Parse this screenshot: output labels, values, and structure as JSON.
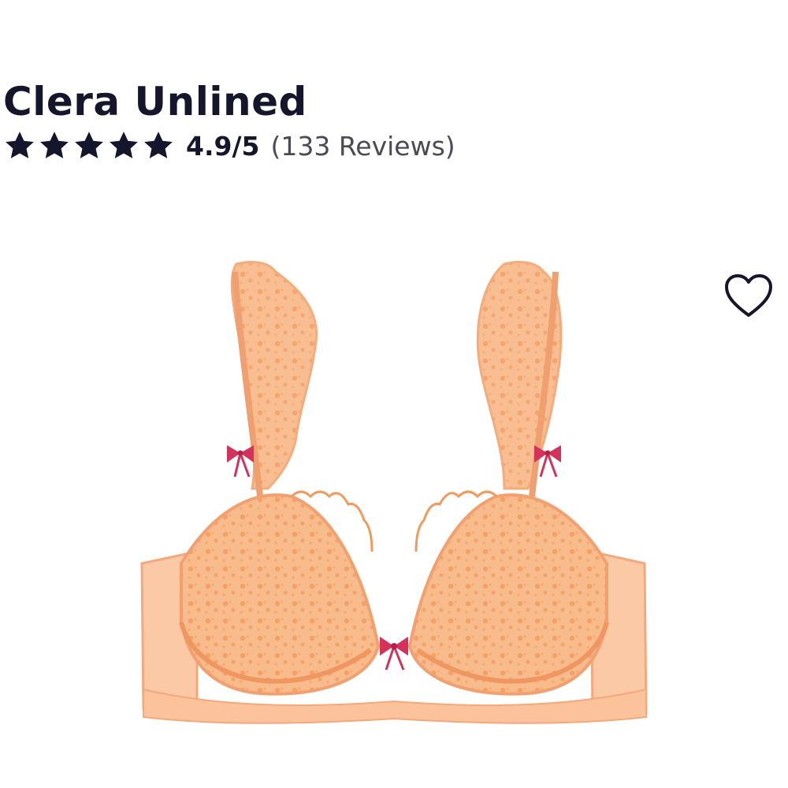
{
  "product": {
    "title": "Clera Unlined",
    "rating": {
      "stars_filled": 5,
      "stars_total": 5,
      "score_text": "4.9/5",
      "reviews_text": "(133 Reviews)"
    },
    "image": {
      "alt": "Clera Unlined"
    },
    "wishlist_icon": "heart-outline-icon"
  },
  "colors": {
    "text": "#15152b",
    "secondary_text": "#4a4a55",
    "star": "#15152b",
    "product_peach": "#f7b07c",
    "product_lace": "#f29a5c",
    "bow": "#d4325a"
  }
}
